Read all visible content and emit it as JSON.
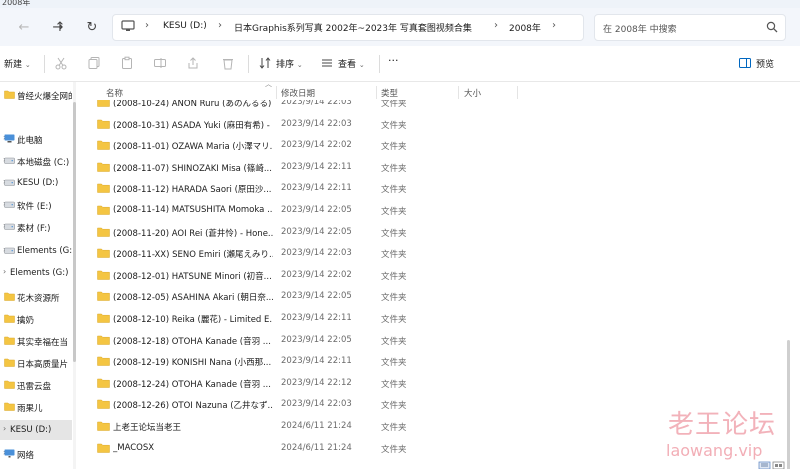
{
  "window": {
    "title": "2008年"
  },
  "nav": {
    "back": "←",
    "forward": "→",
    "up": "↑",
    "refresh": "↻"
  },
  "address": {
    "segments": [
      "KESU (D:)",
      "日本Graphis系列写真 2002年~2023年 写真套图视频合集",
      "2008年"
    ]
  },
  "search": {
    "placeholder": "在 2008年 中搜索"
  },
  "toolbar": {
    "new_label": "新建",
    "sort_label": "排序",
    "view_label": "查看",
    "more_label": "···",
    "preview_label": "预览"
  },
  "navpane": {
    "items": [
      {
        "label": "曾经火爆全网的"
      },
      {
        "label": "此电脑"
      },
      {
        "label": "本地磁盘 (C:)"
      },
      {
        "label": "KESU (D:)"
      },
      {
        "label": "软件 (E:)"
      },
      {
        "label": "素材 (F:)"
      },
      {
        "label": "Elements (G:)"
      },
      {
        "label": "Elements (G:)"
      },
      {
        "label": "花木资源所"
      },
      {
        "label": "擒奶"
      },
      {
        "label": "其实幸福在当"
      },
      {
        "label": "日本高质量片"
      },
      {
        "label": "迅雷云盘"
      },
      {
        "label": "雨果儿"
      },
      {
        "label": "KESU (D:)"
      },
      {
        "label": "网络"
      }
    ]
  },
  "columns": {
    "name": "名称",
    "modified": "修改日期",
    "type": "类型",
    "size": "大小"
  },
  "files": [
    {
      "name": "(2008-10-24) ANON Ruru (あのんるる)",
      "date": "2023/9/14 22:03",
      "type": "文件夹"
    },
    {
      "name": "(2008-10-31) ASADA Yuki (麻田有希) - ...",
      "date": "2023/9/14 22:03",
      "type": "文件夹"
    },
    {
      "name": "(2008-11-01) OZAWA Maria (小澤マリ...",
      "date": "2023/9/14 22:02",
      "type": "文件夹"
    },
    {
      "name": "(2008-11-07) SHINOZAKI Misa (篠崎...",
      "date": "2023/9/14 22:11",
      "type": "文件夹"
    },
    {
      "name": "(2008-11-12) HARADA Saori (原田沙...",
      "date": "2023/9/14 22:11",
      "type": "文件夹"
    },
    {
      "name": "(2008-11-14) MATSUSHITA Momoka ...",
      "date": "2023/9/14 22:05",
      "type": "文件夹"
    },
    {
      "name": "(2008-11-20) AOI Rei (蒼井怜) - Hone...",
      "date": "2023/9/14 22:05",
      "type": "文件夹"
    },
    {
      "name": "(2008-11-XX) SENO Emiri (瀬尾えみり...",
      "date": "2023/9/14 22:03",
      "type": "文件夹"
    },
    {
      "name": "(2008-12-01) HATSUNE Minori (初音...",
      "date": "2023/9/14 22:02",
      "type": "文件夹"
    },
    {
      "name": "(2008-12-05) ASAHINA Akari (朝日奈...",
      "date": "2023/9/14 22:05",
      "type": "文件夹"
    },
    {
      "name": "(2008-12-10) Reika (麗花) - Limited E...",
      "date": "2023/9/14 22:11",
      "type": "文件夹"
    },
    {
      "name": "(2008-12-18) OTOHA Kanade (音羽 ...",
      "date": "2023/9/14 22:05",
      "type": "文件夹"
    },
    {
      "name": "(2008-12-19) KONISHI Nana (小西那...",
      "date": "2023/9/14 22:11",
      "type": "文件夹"
    },
    {
      "name": "(2008-12-24) OTOHA Kanade (音羽 ...",
      "date": "2023/9/14 22:12",
      "type": "文件夹"
    },
    {
      "name": "(2008-12-26) OTOI Nazuna (乙井なず...",
      "date": "2023/9/14 22:03",
      "type": "文件夹"
    },
    {
      "name": "上老王论坛当老王",
      "date": "2024/6/11 21:24",
      "type": "文件夹"
    },
    {
      "name": "_MACOSX",
      "date": "2024/6/11 21:24",
      "type": "文件夹"
    }
  ],
  "watermark": {
    "cn": "老王论坛",
    "url": "laowang.vip"
  },
  "colors": {
    "folder": "#f4c542",
    "selected": "#e5e5e5",
    "accent": "#0067c0"
  }
}
